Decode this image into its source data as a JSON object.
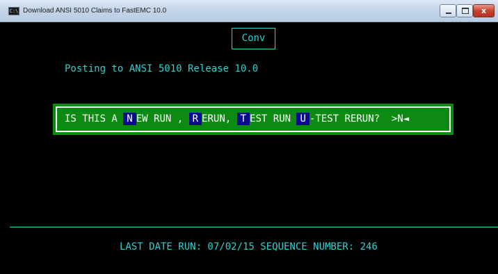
{
  "window": {
    "title": "Download ANSI 5010 Claims to FastEMC 10.0",
    "icon_label": "C:\\",
    "close_glyph": "x"
  },
  "console": {
    "conv_label": "Conv",
    "posting_text": "Posting to ANSI 5010 Release 10.0",
    "prompt": {
      "prefix": "IS THIS A ",
      "key_new": "N",
      "new_rest": "EW RUN , ",
      "key_rerun": "R",
      "rerun_rest": "ERUN, ",
      "key_test": "T",
      "test_rest": "EST RUN ",
      "key_utest": "U",
      "utest_rest": "-TEST RERUN?  >N◄"
    },
    "status_line": "LAST DATE RUN: 07/02/15 SEQUENCE NUMBER: 246"
  },
  "colors": {
    "console_bg": "#000000",
    "console_text": "#2ad2d2",
    "prompt_bg": "#0c8a12",
    "hotkey_bg": "#0a0a8c"
  },
  "icons": [
    "console-app-icon",
    "minimize-icon",
    "maximize-icon",
    "close-icon"
  ]
}
